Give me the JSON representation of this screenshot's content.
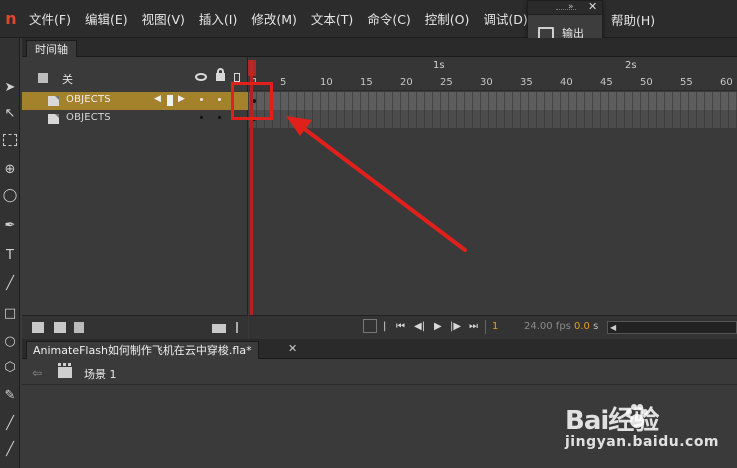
{
  "menubar": {
    "logo_glyph": "n",
    "items": [
      "文件(F)",
      "编辑(E)",
      "视图(V)",
      "插入(I)",
      "修改(M)",
      "文本(T)",
      "命令(C)",
      "控制(O)",
      "调试(D)"
    ],
    "help_label": "帮助(H)"
  },
  "output_panel": {
    "collapse_glyph": "»",
    "close_glyph": "✕",
    "label": "输出",
    "icon": "monitor-icon"
  },
  "timeline": {
    "tab_label": "时间轴",
    "header_label": "关",
    "layers": [
      {
        "name": "OBJECTS",
        "active": true,
        "keyframe_position": [
          0,
          1
        ]
      },
      {
        "name": "OBJECTS",
        "active": false
      }
    ],
    "ruler": {
      "seconds": [
        "1s",
        "2s"
      ],
      "frames": [
        "1",
        "5",
        "10",
        "15",
        "20",
        "25",
        "30",
        "35",
        "40",
        "45",
        "50",
        "55",
        "60"
      ]
    },
    "current_frame": "1",
    "fps": "24.00 fps",
    "time": "0.0",
    "time_unit": "s"
  },
  "document": {
    "tab_label": "AnimateFlash如何制作飞机在云中穿梭.fla*",
    "close_glyph": "✕",
    "scene_label": "场景 1"
  },
  "watermark": {
    "brand": "Bai经验",
    "url": "jingyan.baidu.com"
  },
  "colors": {
    "accent_highlight": "#e1201c",
    "active_layer": "#a4822c",
    "playhead": "#b52121"
  }
}
